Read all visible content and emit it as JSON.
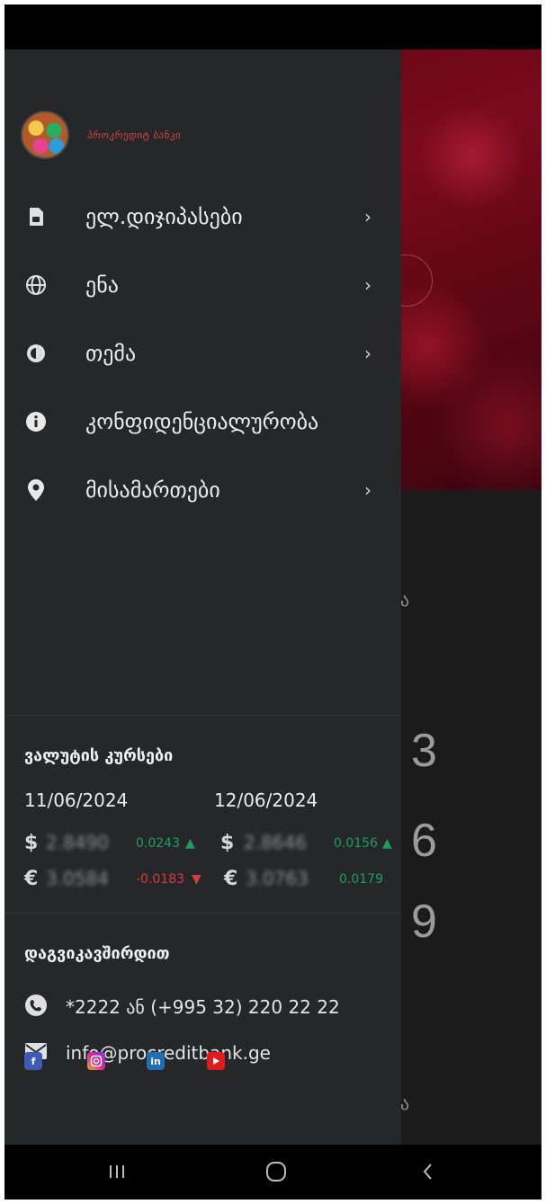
{
  "brand": {
    "name": "პროკრედიტ ბანკი"
  },
  "menu": [
    {
      "icon": "sim-card-icon",
      "label": "ელ.დიჯიპასები",
      "chevron": "›"
    },
    {
      "icon": "globe-icon",
      "label": "ენა",
      "chevron": "›"
    },
    {
      "icon": "contrast-icon",
      "label": "თემა",
      "chevron": "›"
    },
    {
      "icon": "info-icon",
      "label": "კონფიდენციალურობა",
      "chevron": ""
    },
    {
      "icon": "location-pin-icon",
      "label": "მისამართები",
      "chevron": "›"
    }
  ],
  "rates": {
    "title": "ვალუტის კურსები",
    "date1": "11/06/2024",
    "date2": "12/06/2024",
    "rows": [
      {
        "symbol": "$",
        "left": {
          "value": "2.8490",
          "change": "0.0243",
          "dir": "up"
        },
        "right": {
          "value": "2.8646",
          "change": "0.0156",
          "dir": "up"
        }
      },
      {
        "symbol": "€",
        "left": {
          "value": "3.0584",
          "change": "-0.0183",
          "dir": "down"
        },
        "right": {
          "value": "3.0763",
          "change": "0.0179",
          "dir": "up"
        }
      }
    ]
  },
  "contact": {
    "title": "დაგვიკავშირდით",
    "phone": "*2222 ან (+995 32) 220 22 22",
    "email": "info@procreditbank.ge"
  },
  "social": [
    "facebook-icon",
    "instagram-icon",
    "linkedin-icon",
    "youtube-icon"
  ],
  "background": {
    "numbers": [
      "3",
      "6",
      "9"
    ],
    "fragments": [
      "ა",
      "ა"
    ]
  },
  "colors": {
    "drawer_bg": "#262729",
    "brand_red": "#d9463e",
    "up": "#1f9d60",
    "down": "#d93a3a"
  }
}
